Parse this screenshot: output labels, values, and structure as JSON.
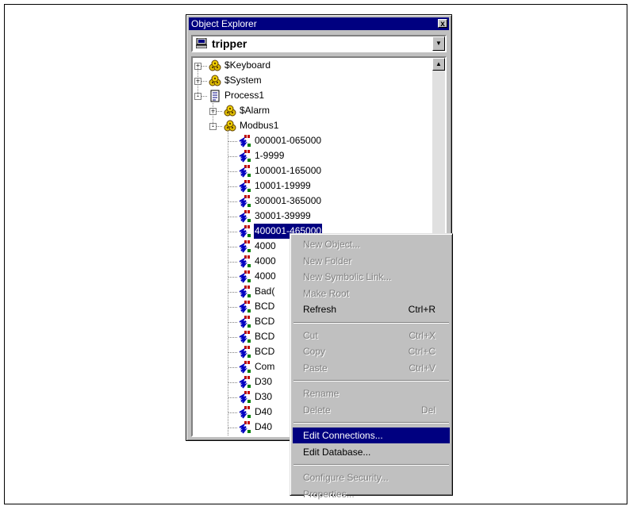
{
  "window": {
    "title": "Object Explorer",
    "close_label": "x"
  },
  "combo": {
    "value": "tripper"
  },
  "tree": [
    {
      "label": "$Keyboard",
      "level": 0,
      "expander": "+",
      "icon": "gear-group-icon"
    },
    {
      "label": "$System",
      "level": 0,
      "expander": "+",
      "icon": "gear-group-icon"
    },
    {
      "label": "Process1",
      "level": 0,
      "expander": "-",
      "icon": "document-icon"
    },
    {
      "label": "$Alarm",
      "level": 1,
      "expander": "+",
      "icon": "gear-group-icon"
    },
    {
      "label": "Modbus1",
      "level": 1,
      "expander": "-",
      "icon": "gear-group-icon"
    },
    {
      "label": "000001-065000",
      "level": 2,
      "icon": "io-point-icon"
    },
    {
      "label": "1-9999",
      "level": 2,
      "icon": "io-point-icon"
    },
    {
      "label": "100001-165000",
      "level": 2,
      "icon": "io-point-icon"
    },
    {
      "label": "10001-19999",
      "level": 2,
      "icon": "io-point-icon"
    },
    {
      "label": "300001-365000",
      "level": 2,
      "icon": "io-point-icon"
    },
    {
      "label": "30001-39999",
      "level": 2,
      "icon": "io-point-icon"
    },
    {
      "label": "400001-465000",
      "level": 2,
      "icon": "io-point-icon",
      "selected": true
    },
    {
      "label": "4000",
      "level": 2,
      "icon": "io-point-icon"
    },
    {
      "label": "4000",
      "level": 2,
      "icon": "io-point-icon"
    },
    {
      "label": "4000",
      "level": 2,
      "icon": "io-point-icon"
    },
    {
      "label": "Bad(",
      "level": 2,
      "icon": "io-point-icon"
    },
    {
      "label": "BCD",
      "level": 2,
      "icon": "io-point-icon"
    },
    {
      "label": "BCD",
      "level": 2,
      "icon": "io-point-icon"
    },
    {
      "label": "BCD",
      "level": 2,
      "icon": "io-point-icon"
    },
    {
      "label": "BCD",
      "level": 2,
      "icon": "io-point-icon"
    },
    {
      "label": "Com",
      "level": 2,
      "icon": "io-point-icon"
    },
    {
      "label": "D30",
      "level": 2,
      "icon": "io-point-icon"
    },
    {
      "label": "D30",
      "level": 2,
      "icon": "io-point-icon"
    },
    {
      "label": "D40",
      "level": 2,
      "icon": "io-point-icon"
    },
    {
      "label": "D40",
      "level": 2,
      "icon": "io-point-icon"
    }
  ],
  "menu": [
    {
      "label": "New Object...",
      "shortcut": "",
      "disabled": true
    },
    {
      "label": "New Folder",
      "shortcut": "",
      "disabled": true
    },
    {
      "label": "New Symbolic Link...",
      "shortcut": "",
      "disabled": true
    },
    {
      "label": "Make Root",
      "shortcut": "",
      "disabled": true
    },
    {
      "label": "Refresh",
      "shortcut": "Ctrl+R",
      "disabled": false
    },
    {
      "sep": true
    },
    {
      "label": "Cut",
      "shortcut": "Ctrl+X",
      "disabled": true
    },
    {
      "label": "Copy",
      "shortcut": "Ctrl+C",
      "disabled": true
    },
    {
      "label": "Paste",
      "shortcut": "Ctrl+V",
      "disabled": true
    },
    {
      "sep": true
    },
    {
      "label": "Rename",
      "shortcut": "",
      "disabled": true
    },
    {
      "label": "Delete",
      "shortcut": "Del",
      "disabled": true
    },
    {
      "sep": true
    },
    {
      "label": "Edit Connections...",
      "shortcut": "",
      "disabled": false,
      "highlighted": true
    },
    {
      "label": "Edit Database...",
      "shortcut": "",
      "disabled": false
    },
    {
      "sep": true
    },
    {
      "label": "Configure Security...",
      "shortcut": "",
      "disabled": true
    },
    {
      "label": "Properties...",
      "shortcut": "",
      "disabled": true
    }
  ],
  "colors": {
    "selection": "#000080",
    "face": "#c0c0c0"
  }
}
